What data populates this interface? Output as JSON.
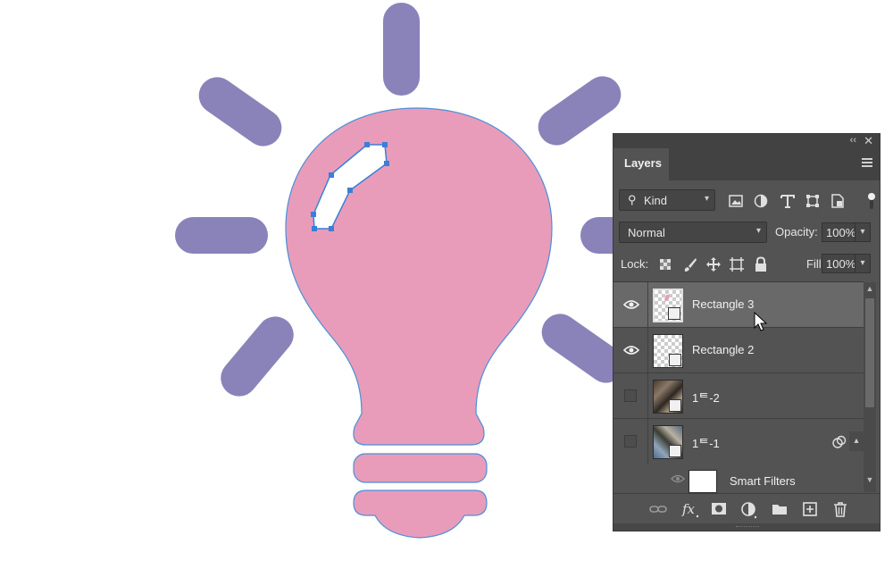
{
  "canvas": {
    "artwork": "light-bulb",
    "bulb_color": "#e89cba",
    "ray_color": "#8a83b9",
    "path_color": "#4a8fd8"
  },
  "panel": {
    "tab_title": "Layers",
    "filter_kind": "Kind",
    "blend_mode": "Normal",
    "opacity_label": "Opacity:",
    "opacity_value": "100%",
    "lock_label": "Lock:",
    "fill_label": "Fill:",
    "fill_value": "100%",
    "smart_filters_label": "Smart Filters",
    "layers": [
      {
        "name": "Rectangle 3",
        "visible": true,
        "selected": true
      },
      {
        "name": "Rectangle 2",
        "visible": true,
        "selected": false
      },
      {
        "name": "1ᄐ-2",
        "visible": false,
        "selected": false
      },
      {
        "name": "1ᄐ-1",
        "visible": false,
        "selected": false
      }
    ],
    "colors": {
      "panel_bg": "#535353",
      "selected_row": "#696969",
      "tab_bar": "#424242"
    }
  }
}
